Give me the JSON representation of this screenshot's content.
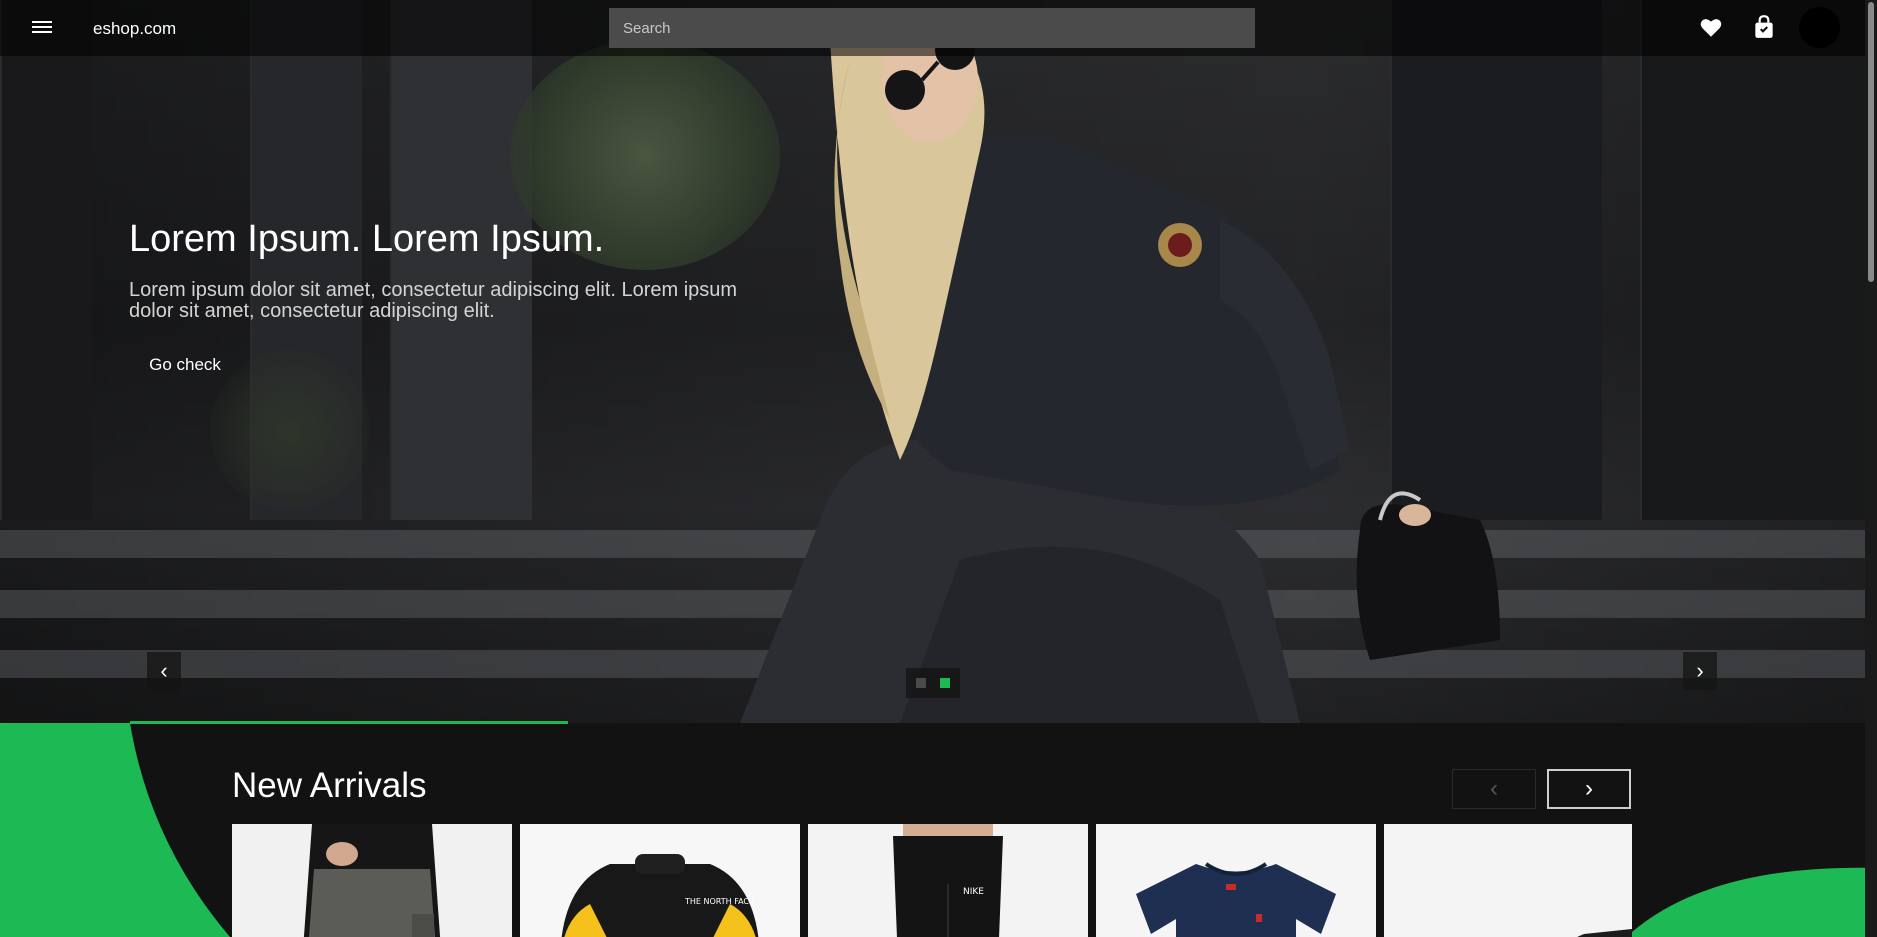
{
  "header": {
    "brand": "eshop.com",
    "search_placeholder": "Search",
    "icons": [
      "menu-icon",
      "heart-icon",
      "shopping-bag-icon"
    ]
  },
  "hero": {
    "title": "Lorem Ipsum. Lorem Ipsum.",
    "description": "Lorem ipsum dolor sit amet, consectetur adipiscing elit. Lorem ipsum dolor sit amet, consectetur adipiscing elit.",
    "cta_label": "Go check",
    "prev_glyph": "‹",
    "next_glyph": "›",
    "slides": [
      {
        "active": false
      },
      {
        "active": true
      }
    ]
  },
  "new_arrivals": {
    "title": "New Arrivals",
    "prev_glyph": "‹",
    "next_glyph": "›",
    "products": [
      {
        "name": "cargo-pants"
      },
      {
        "name": "puffer-jacket"
      },
      {
        "name": "leggings"
      },
      {
        "name": "t-shirt"
      },
      {
        "name": "sneaker"
      }
    ]
  },
  "colors": {
    "accent": "#1db954",
    "background": "#121212",
    "inactive_dot": "#4a4a4a"
  }
}
